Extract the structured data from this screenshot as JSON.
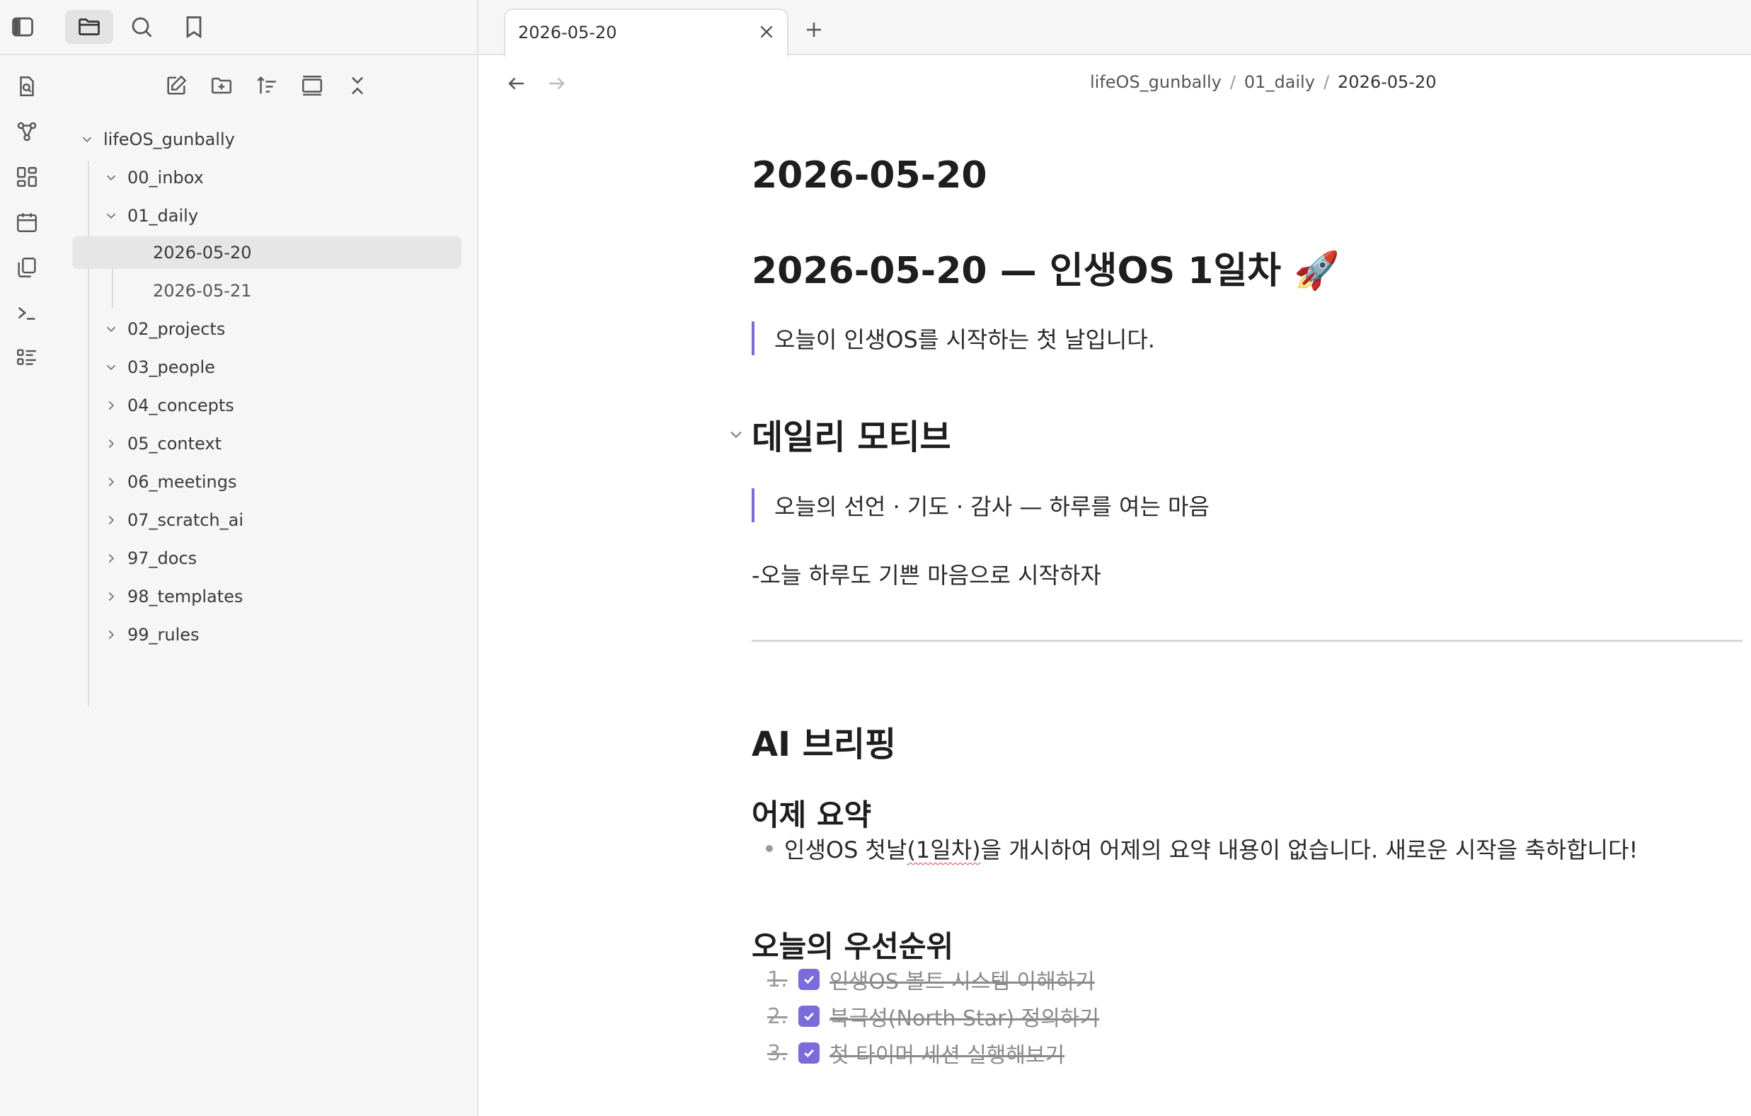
{
  "colors": {
    "accent": "#7b6cd9",
    "sidebar_bg": "#f6f6f6",
    "active_item_bg": "#e6e6e6",
    "border": "#e3e3e3"
  },
  "top_icons": [
    "sidebar-toggle-icon",
    "folder-icon",
    "search-icon",
    "bookmark-icon"
  ],
  "ribbon_icons": [
    "open-quick-switcher-icon",
    "graph-view-icon",
    "canvas-icon",
    "calendar-icon",
    "templates-icon",
    "command-palette-icon",
    "outline-icon"
  ],
  "sidebar": {
    "actions": [
      "new-note-icon",
      "new-folder-icon",
      "sort-icon",
      "collapse-icon",
      "close-icon"
    ],
    "vault": "lifeOS_gunbally",
    "folders": [
      {
        "label": "00_inbox",
        "expanded": true
      },
      {
        "label": "01_daily",
        "expanded": true
      },
      {
        "label": "02_projects",
        "expanded": true
      },
      {
        "label": "03_people",
        "expanded": true
      },
      {
        "label": "04_concepts",
        "expanded": false
      },
      {
        "label": "05_context",
        "expanded": false
      },
      {
        "label": "06_meetings",
        "expanded": false
      },
      {
        "label": "07_scratch_ai",
        "expanded": false
      },
      {
        "label": "97_docs",
        "expanded": false
      },
      {
        "label": "98_templates",
        "expanded": false
      },
      {
        "label": "99_rules",
        "expanded": false
      }
    ],
    "daily_files": [
      "2026-05-20",
      "2026-05-21"
    ],
    "active_file": "2026-05-20"
  },
  "tab": {
    "title": "2026-05-20"
  },
  "breadcrumb": [
    "lifeOS_gunbally",
    "01_daily",
    "2026-05-20"
  ],
  "note": {
    "title": "2026-05-20",
    "heading": "2026-05-20 — 인생OS 1일차 🚀",
    "intro_quote": "오늘이 인생OS를 시작하는 첫 날입니다.",
    "section_motive": {
      "title": "데일리 모티브",
      "quote": "오늘의 선언 · 기도 · 감사 — 하루를 여는 마음",
      "line": "-오늘 하루도 기쁜 마음으로 시작하자"
    },
    "section_ai": {
      "title": "AI 브리핑",
      "yesterday": {
        "title": "어제 요약",
        "bullet_parts": [
          "인생OS 첫날",
          "(1일차)",
          "을 개시하여 어제의 요약 내용이 없습니다. 새로운 시작을 축하합니다!"
        ]
      },
      "priorities": {
        "title": "오늘의 우선순위",
        "tasks": [
          {
            "num": "1.",
            "text": "인생OS 볼트 시스템 이해하기",
            "done": true
          },
          {
            "num": "2.",
            "text": "북극성(North Star) 정의하기",
            "done": true
          },
          {
            "num": "3.",
            "text": "첫 타이머 세션 실행해보기",
            "done": true
          }
        ]
      }
    }
  }
}
